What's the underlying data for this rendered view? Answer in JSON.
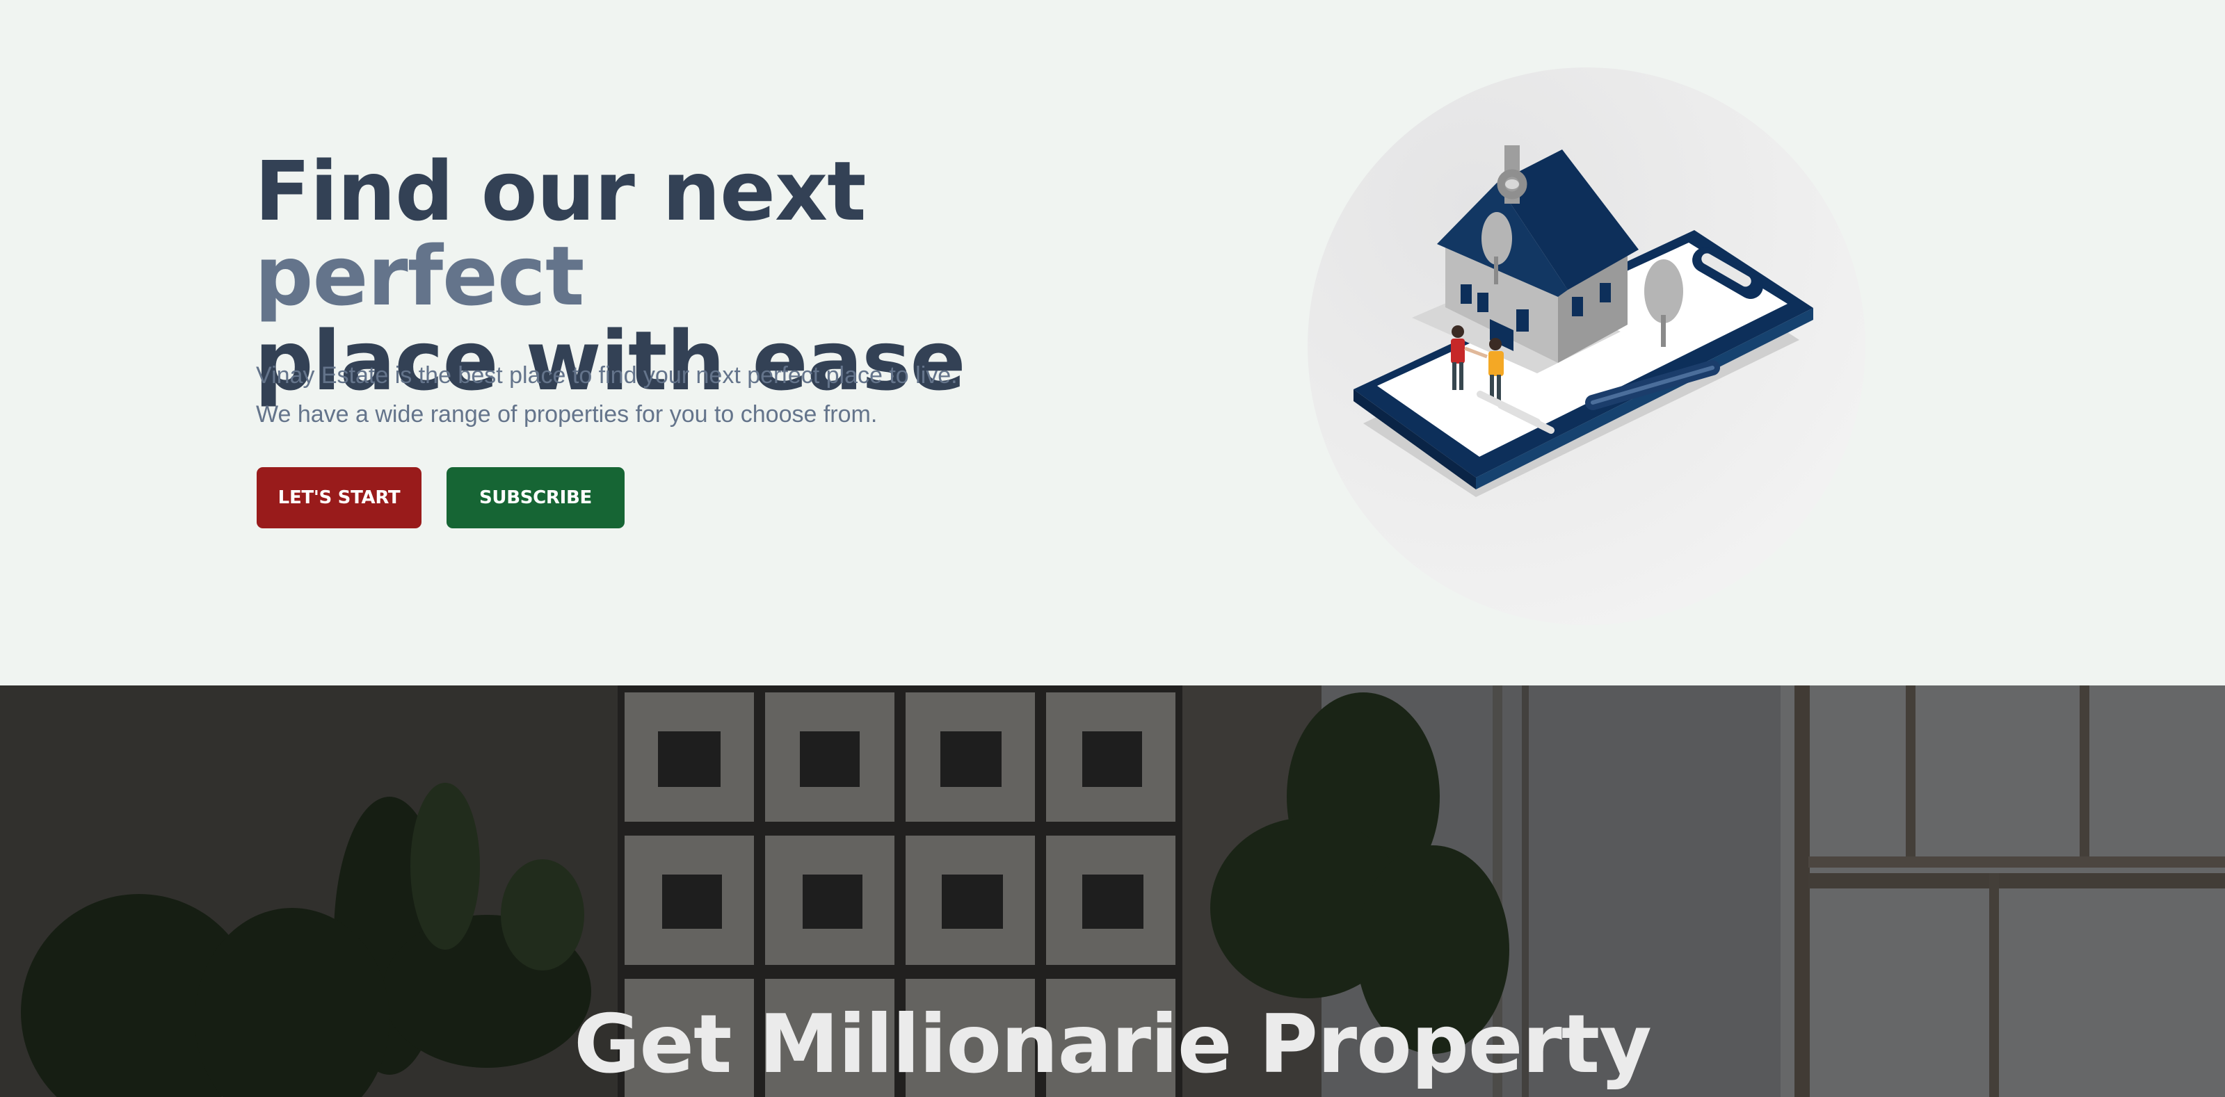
{
  "hero": {
    "headline_part1": "Find our next ",
    "headline_accent": "perfect",
    "headline_part2": "place with ease",
    "subtext_line1": "Vinay Estate is the best place to find your next perfect place to live.",
    "subtext_line2": "We have a wide range of properties for you to choose from.",
    "primary_button": "LET'S START",
    "secondary_button": "SUBSCRIBE",
    "illustration_icon": "house-on-clipboard-illustration"
  },
  "banner": {
    "title": "Get Millionarie Property",
    "background_image": "living-room-photo-wall-with-plants"
  },
  "colors": {
    "background": "#f0f4f1",
    "heading": "#334155",
    "accent": "#64748b",
    "primary_button": "#991b1b",
    "secondary_button": "#166534"
  }
}
